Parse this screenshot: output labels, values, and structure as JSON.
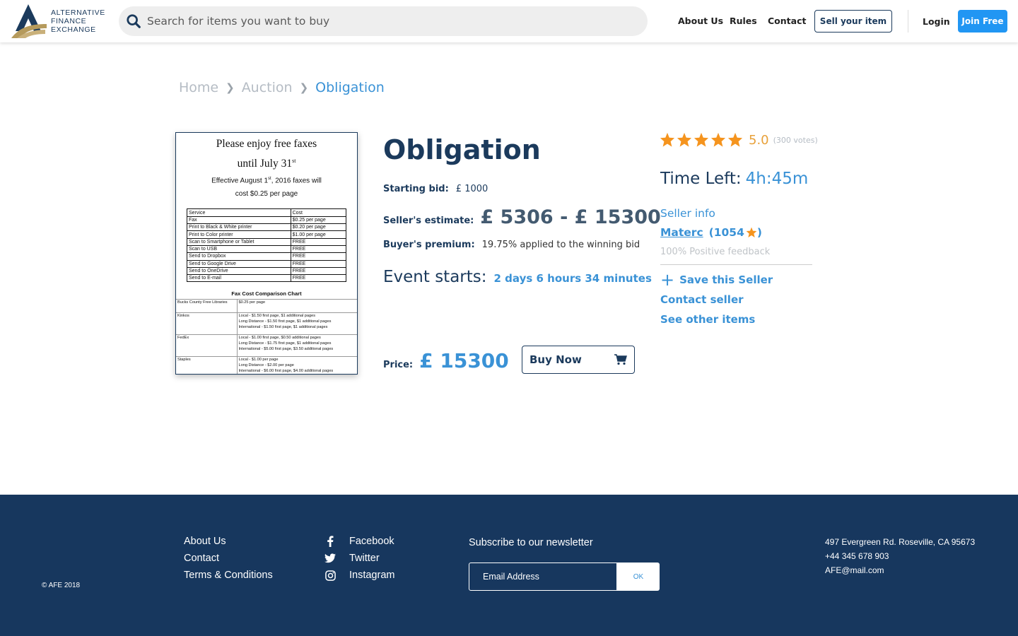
{
  "header": {
    "logo_lines": [
      "ALTERNATIVE",
      "FINANCE",
      "EXCHANGE"
    ],
    "search_placeholder": "Search for items you want to buy",
    "nav": {
      "about": "About Us",
      "rules": "Rules",
      "contact": "Contact"
    },
    "sell_label": "Sell your item",
    "login_label": "Login",
    "join_label": "Join Free"
  },
  "breadcrumb": [
    "Home",
    "Auction",
    "Obligation"
  ],
  "product_image": {
    "title_line1": "Please enjoy free faxes",
    "title_line2": "until July 31",
    "title_line2_sup": "st",
    "sub_line1_a": "Effective August 1",
    "sub_line1_sup": "st",
    "sub_line1_b": ", 2016 faxes will",
    "sub_line2": "cost $0.25 per page",
    "table_headers": [
      "Service",
      "Cost"
    ],
    "table_rows": [
      [
        "Fax",
        "$0.25 per page"
      ],
      [
        "Print to Black & White printer",
        "$0.20 per page"
      ],
      [
        "Print to Color printer",
        "$1.00 per page"
      ],
      [
        "Scan to Smartphone or Tablet",
        "FREE"
      ],
      [
        "Scan to USB",
        "FREE"
      ],
      [
        "Send to Dropbox",
        "FREE"
      ],
      [
        "Send to Google Drive",
        "FREE"
      ],
      [
        "Send to OneDrive",
        "FREE"
      ],
      [
        "Send to E-mail",
        "FREE"
      ]
    ],
    "chart_title": "Fax Cost Comparison Chart",
    "comparison": [
      {
        "name": "Bucks County Free Libraries",
        "lines": [
          "$0.25 per page"
        ]
      },
      {
        "name": "Kinkos",
        "lines": [
          "Local - $1.50 first page, $1 additional pages",
          "Long Distance - $1.50 first page, $1 additional pages",
          "International - $1.50 first page, $1 additional pages"
        ]
      },
      {
        "name": "FedEx",
        "lines": [
          "Local - $1.00 first page, $0.50 additional pages",
          "Long Distance - $1.75 first page, $1 additional pages",
          "International - $5.00 first page, $3.50 additional pages"
        ]
      },
      {
        "name": "Staples",
        "lines": [
          "Local - $1.00 per page",
          "Long Distance - $2.00 per page",
          "International - $6.00 first page, $4.00 additional pages"
        ]
      }
    ]
  },
  "product": {
    "title": "Obligation",
    "starting_bid_label": "Starting bid:",
    "starting_bid": "£ 1000",
    "estimate_label": "Seller's estimate:",
    "estimate": "£ 5306 - £ 15300",
    "premium_label": "Buyer's premium:",
    "premium": "19.75% applied to the winning bid",
    "event_label": "Event starts:",
    "event_value": "2 days 6 hours 34 minutes",
    "price_label": "Price:",
    "price": "£ 15300",
    "buy_label": "Buy Now"
  },
  "seller_panel": {
    "rating": 5,
    "rating_text": "5.0",
    "votes": "(300 votes)",
    "time_left_label": "Time Left:",
    "time_left": "4h:45m",
    "seller_info_label": "Seller info",
    "seller_name": "Materc",
    "seller_count_open": "(1054",
    "seller_count_close": ")",
    "feedback": "100% Positive feedback",
    "save_seller": "Save this Seller",
    "contact_seller": "Contact seller",
    "see_items": "See other items"
  },
  "footer": {
    "copyright": "© AFE 2018",
    "links": [
      "About Us",
      "Contact",
      "Terms & Conditions"
    ],
    "social": [
      "Facebook",
      "Twitter",
      "Instagram"
    ],
    "newsletter_title": "Subscribe to our newsletter",
    "email_placeholder": "Email Address",
    "ok_label": "OK",
    "address": "497 Evergreen Rd. Roseville, CA 95673",
    "phone": "+44 345 678 903",
    "email": "AFE@mail.com"
  },
  "colors": {
    "navy": "#1b3a5c",
    "accent_blue": "#3a92d6",
    "join_blue": "#2196f3",
    "star_orange": "#f5941e",
    "footer_bg": "#17375e"
  }
}
